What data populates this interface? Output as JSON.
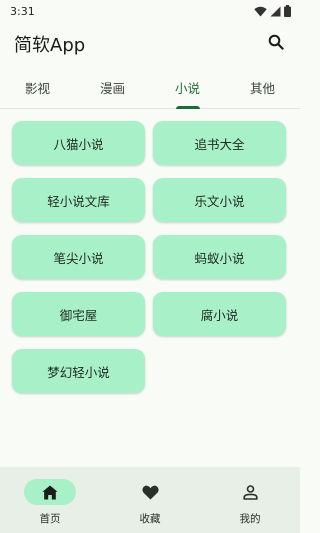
{
  "status": {
    "time": "3:31"
  },
  "app": {
    "title": "简软App"
  },
  "icons": {
    "search": "search-icon",
    "home": "home-icon",
    "favorite": "heart-icon",
    "profile": "person-icon"
  },
  "colors": {
    "accent": "#1e6b3a",
    "card": "#a8f0c8",
    "background": "#f8fbf6",
    "nav_background": "#e8efe6"
  },
  "tabs": [
    {
      "label": "影视",
      "active": false
    },
    {
      "label": "漫画",
      "active": false
    },
    {
      "label": "小说",
      "active": true
    },
    {
      "label": "其他",
      "active": false
    }
  ],
  "sources": [
    {
      "label": "八猫小说"
    },
    {
      "label": "追书大全"
    },
    {
      "label": "轻小说文库"
    },
    {
      "label": "乐文小说"
    },
    {
      "label": "笔尖小说"
    },
    {
      "label": "蚂蚁小说"
    },
    {
      "label": "御宅屋"
    },
    {
      "label": "腐小说"
    },
    {
      "label": "梦幻轻小说"
    }
  ],
  "bottom_nav": [
    {
      "label": "首页",
      "active": true
    },
    {
      "label": "收藏",
      "active": false
    },
    {
      "label": "我的",
      "active": false
    }
  ]
}
